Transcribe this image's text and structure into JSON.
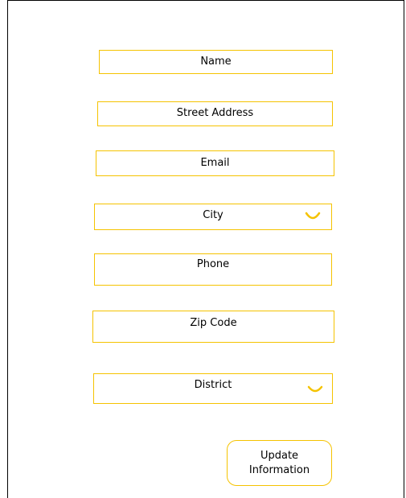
{
  "form": {
    "fields": {
      "name": {
        "label": "Name"
      },
      "street_address": {
        "label": "Street Address"
      },
      "email": {
        "label": "Email"
      },
      "city": {
        "label": "City",
        "icon": "chevron-down-icon"
      },
      "phone": {
        "label": "Phone"
      },
      "zip_code": {
        "label": "Zip Code"
      },
      "district": {
        "label": "District",
        "icon": "chevron-down-icon"
      }
    },
    "submit": {
      "line1": "Update",
      "line2": "Information"
    }
  },
  "colors": {
    "border_accent": "#f5c300",
    "background": "#ffffff",
    "text": "#000000",
    "frame": "#000000"
  }
}
